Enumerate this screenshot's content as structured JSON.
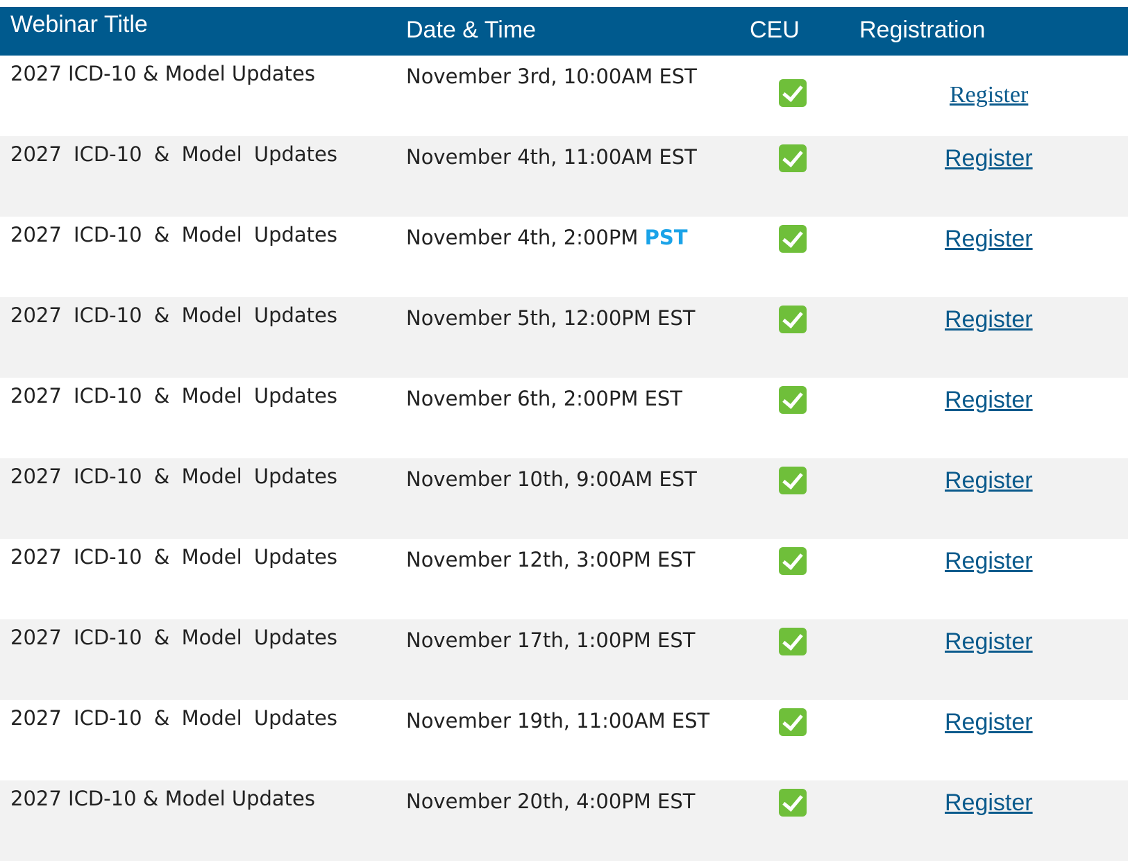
{
  "table": {
    "headers": {
      "title": "Webinar Title",
      "date": "Date & Time",
      "ceu": "CEU",
      "registration": "Registration"
    },
    "rows": [
      {
        "title": "2027 ICD-10 & Model Updates",
        "date_main": "November 3rd, 10:00AM",
        "date_tz": "EST",
        "tz_accent": false,
        "ceu": "check-icon",
        "link": "Register"
      },
      {
        "title": "2027 ICD-10 & Model Updates",
        "date_main": "November 4th, 11:00AM",
        "date_tz": "EST",
        "tz_accent": false,
        "ceu": "check-icon",
        "link": "Register"
      },
      {
        "title": "2027 ICD-10 & Model Updates",
        "date_main": "November 4th, 2:00PM",
        "date_tz": "PST",
        "tz_accent": true,
        "ceu": "check-icon",
        "link": "Register"
      },
      {
        "title": "2027 ICD-10 & Model Updates",
        "date_main": "November 5th, 12:00PM",
        "date_tz": "EST",
        "tz_accent": false,
        "ceu": "check-icon",
        "link": "Register"
      },
      {
        "title": "2027 ICD-10 & Model Updates",
        "date_main": "November 6th, 2:00PM",
        "date_tz": "EST",
        "tz_accent": false,
        "ceu": "check-icon",
        "link": "Register"
      },
      {
        "title": "2027 ICD-10 & Model Updates",
        "date_main": "November 10th, 9:00AM",
        "date_tz": "EST",
        "tz_accent": false,
        "ceu": "check-icon",
        "link": "Register"
      },
      {
        "title": "2027 ICD-10 & Model Updates",
        "date_main": "November 12th, 3:00PM",
        "date_tz": "EST",
        "tz_accent": false,
        "ceu": "check-icon",
        "link": "Register"
      },
      {
        "title": "2027 ICD-10 & Model Updates",
        "date_main": "November 17th, 1:00PM",
        "date_tz": "EST",
        "tz_accent": false,
        "ceu": "check-icon",
        "link": "Register"
      },
      {
        "title": "2027 ICD-10 & Model Updates",
        "date_main": "November 19th, 11:00AM",
        "date_tz": "EST",
        "tz_accent": false,
        "ceu": "check-icon",
        "link": "Register"
      },
      {
        "title": "2027 ICD-10 & Model Updates",
        "date_main": "November 20th, 4:00PM",
        "date_tz": "EST",
        "tz_accent": false,
        "ceu": "check-icon",
        "link": "Register"
      }
    ]
  },
  "colors": {
    "header_bg": "#005a8e",
    "stripe_bg": "#f2f2f2",
    "link": "#0a5a8c",
    "tz_accent": "#1aa3e8",
    "check": "#6fbf3a"
  }
}
